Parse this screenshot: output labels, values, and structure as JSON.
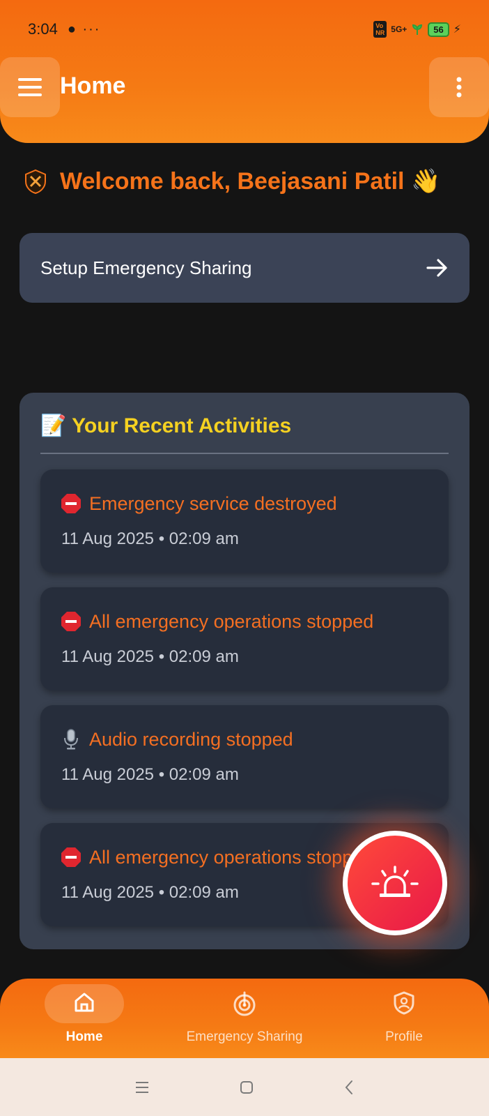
{
  "status_bar": {
    "time": "3:04",
    "left_icons": "● ···",
    "volte": "Vo\nNR",
    "network": "5G+",
    "battery": "56"
  },
  "header": {
    "title": "Home",
    "menu_icon": "hamburger-icon",
    "more_icon": "kebab-icon"
  },
  "welcome": {
    "text": "Welcome back, Beejasani Patil 👋"
  },
  "setup": {
    "label": "Setup Emergency Sharing"
  },
  "activities": {
    "title": "📝 Your Recent Activities",
    "items": [
      {
        "icon": "stop-sign-icon",
        "title": "Emergency service destroyed",
        "time": "11 Aug 2025 • 02:09 am"
      },
      {
        "icon": "stop-sign-icon",
        "title": "All emergency operations stopped",
        "time": "11 Aug 2025 • 02:09 am"
      },
      {
        "icon": "microphone-icon",
        "title": "Audio recording stopped",
        "time": "11 Aug 2025 • 02:09 am"
      },
      {
        "icon": "stop-sign-icon",
        "title": "All emergency operations stopped",
        "time": "11 Aug 2025 • 02:09 am"
      }
    ]
  },
  "sos": {
    "icon": "siren-icon"
  },
  "bottom_nav": [
    {
      "label": "Home",
      "icon": "home-icon",
      "active": true
    },
    {
      "label": "Emergency Sharing",
      "icon": "radar-icon",
      "active": false
    },
    {
      "label": "Profile",
      "icon": "shield-user-icon",
      "active": false
    }
  ],
  "colors": {
    "accent": "#f57a14",
    "welcome": "#f5731a",
    "activity_title": "#f5d121",
    "activity_item_title": "#f46f22",
    "sos": "#e81848"
  }
}
